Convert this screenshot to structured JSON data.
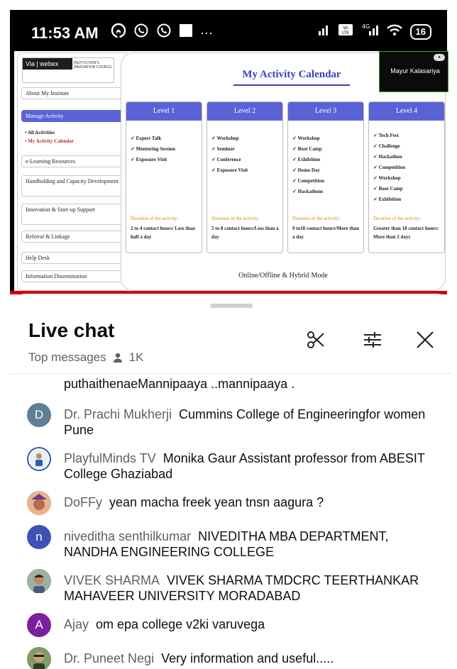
{
  "status_bar": {
    "time": "11:53 AM",
    "left_icons": [
      "hotspot-icon",
      "whatsapp-icon",
      "whatsapp-icon",
      "square-icon",
      "more-icon"
    ],
    "right_icons": [
      "signal-icon",
      "volte-icon",
      "4g-signal-icon",
      "wifi-icon"
    ],
    "battery": "16"
  },
  "slide": {
    "logo_text": "Via | webex",
    "logo_sub": "INSTITUTION'S INNOVATION COUNCIL",
    "sidebar": [
      {
        "label": "About My Institute",
        "active": false
      },
      {
        "label": "Manage Activity",
        "active": true
      },
      {
        "label": "e-Learning Resources",
        "active": false
      },
      {
        "label": "Handholding and Capacity Development",
        "active": false
      },
      {
        "label": "Innovation & Start-up Support",
        "active": false
      },
      {
        "label": "Referral & Linkage",
        "active": false
      },
      {
        "label": "Help Desk",
        "active": false
      },
      {
        "label": "Information Dissemination",
        "active": false
      }
    ],
    "sub_items": [
      "All Activities",
      "My Activity Calendar"
    ],
    "title": "My Activity Calendar",
    "levels": [
      {
        "name": "Level 1",
        "items": [
          "Expert Talk",
          "Mentoring Session",
          "Exposure Visit"
        ],
        "duration_label": "Duration of the activity:",
        "duration": "2 to 4 contact hours/ Less than half a day"
      },
      {
        "name": "Level 2",
        "items": [
          "Workshop",
          "Seminar",
          "Conference",
          "Exposure Visit"
        ],
        "duration_label": "Duration of the activity:",
        "duration": "5 to 8 contact hours/Less than a day"
      },
      {
        "name": "Level 3",
        "items": [
          "Workshop",
          "Boot Camp",
          "Exhibition",
          "Demo Day",
          "Competition",
          "Hackathons"
        ],
        "duration_label": "Duration of the activity:",
        "duration": "9 to18 contact hours/More than a day"
      },
      {
        "name": "Level 4",
        "items": [
          "Tech Fest",
          "Challenge",
          "Hackathon",
          "Competition",
          "Workshop",
          "Boot Camp",
          "Exhibition"
        ],
        "duration_label": "Duration of the activity:",
        "duration": "Greater than 18 contact hours: More than 2 days"
      }
    ],
    "mode": "Online/Offline & Hybrid Mode",
    "video_name": "Mayur Kalasariya"
  },
  "live_chat": {
    "title": "Live chat",
    "filter": "Top messages",
    "viewer_count": "1K",
    "messages": [
      {
        "author": "",
        "text": "puthaithenaeMannipaaya ..mannipaaya .",
        "avatar_letter": "",
        "avatar_color": ""
      },
      {
        "author": "Dr. Prachi Mukherji",
        "text": "Cummins College of Engineeringfor women Pune",
        "avatar_letter": "D",
        "avatar_color": "#5f7f96"
      },
      {
        "author": "PlayfulMinds TV",
        "text": "Monika Gaur Assistant professor from ABESIT College Ghaziabad",
        "avatar_letter": "",
        "avatar_color": "#2b5fa8"
      },
      {
        "author": "DoFFy",
        "text": "yean macha freek yean tnsn aagura ?",
        "avatar_letter": "",
        "avatar_color": "#c9826b"
      },
      {
        "author": "niveditha senthilkumar",
        "text": "NIVEDITHA MBA DEPARTMENT, NANDHA ENGINEERING COLLEGE",
        "avatar_letter": "n",
        "avatar_color": "#3f51b5"
      },
      {
        "author": "VIVEK SHARMA",
        "text": "VIVEK SHARMA TMDCRC TEERTHANKAR MAHAVEER UNIVERSITY MORADABAD",
        "avatar_letter": "",
        "avatar_color": "#8a6a52"
      },
      {
        "author": "Ajay",
        "text": "om epa college v2ki varuvega",
        "avatar_letter": "A",
        "avatar_color": "#7b1fa2"
      },
      {
        "author": "Dr. Puneet Negi",
        "text": "Very information and useful.....",
        "avatar_letter": "",
        "avatar_color": "#6b8a52"
      }
    ]
  }
}
